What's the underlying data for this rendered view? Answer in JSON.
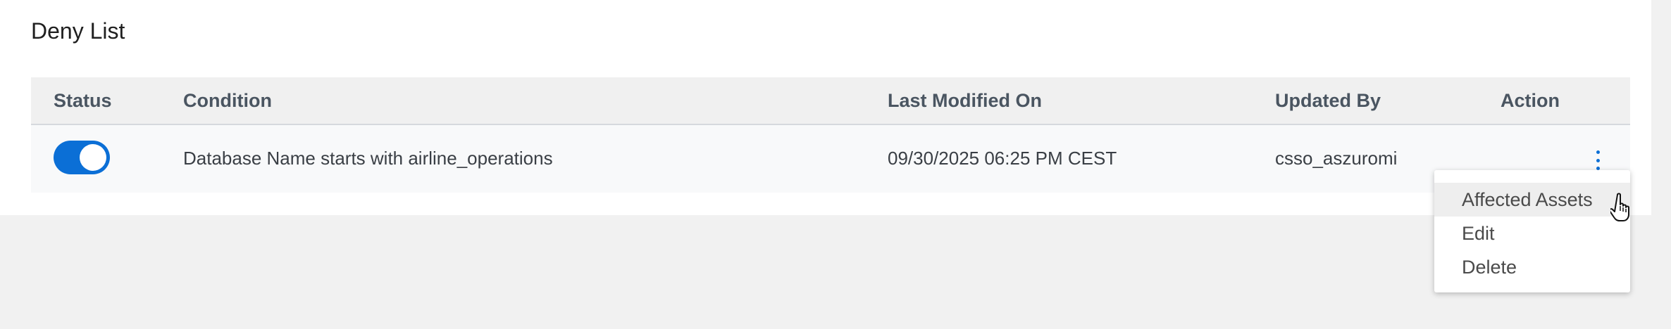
{
  "panel": {
    "title": "Deny List"
  },
  "table": {
    "headers": {
      "status": "Status",
      "condition": "Condition",
      "last_modified": "Last Modified On",
      "updated_by": "Updated By",
      "action": "Action"
    },
    "rows": [
      {
        "status_enabled": true,
        "condition": "Database Name starts with airline_operations",
        "last_modified": "09/30/2025 06:25 PM CEST",
        "updated_by": "csso_aszuromi"
      }
    ]
  },
  "action_menu": {
    "items": [
      "Affected Assets",
      "Edit",
      "Delete"
    ],
    "hovered_index": 0
  },
  "colors": {
    "accent": "#0b6fd6",
    "header_bg": "#f0f0f0",
    "row_bg": "#f8f9fa",
    "page_bg": "#f1f1f1"
  },
  "icons": {
    "row_action": "kebab-menu-icon",
    "cursor": "hand-pointer-icon"
  }
}
